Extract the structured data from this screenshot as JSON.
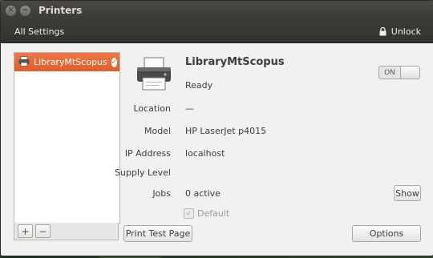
{
  "window": {
    "title": "Printers"
  },
  "toolbar": {
    "all_settings": "All Settings",
    "unlock_label": "Unlock"
  },
  "printers": [
    {
      "name": "LibraryMtScopus",
      "selected": true
    }
  ],
  "list_controls": {
    "add": "+",
    "remove": "−"
  },
  "detail": {
    "name": "LibraryMtScopus",
    "status": "Ready",
    "toggle_label": "ON",
    "location_label": "Location",
    "location_value": "—",
    "model_label": "Model",
    "model_value": "HP LaserJet p4015",
    "ip_label": "IP Address",
    "ip_value": "localhost",
    "supply_label": "Supply Level",
    "jobs_label": "Jobs",
    "jobs_value": "0 active",
    "show_button": "Show",
    "default_label": "Default"
  },
  "buttons": {
    "print_test_page": "Print Test Page",
    "options": "Options"
  },
  "colors": {
    "accent": "#e8622f",
    "titlebar": "#3c3b37"
  }
}
